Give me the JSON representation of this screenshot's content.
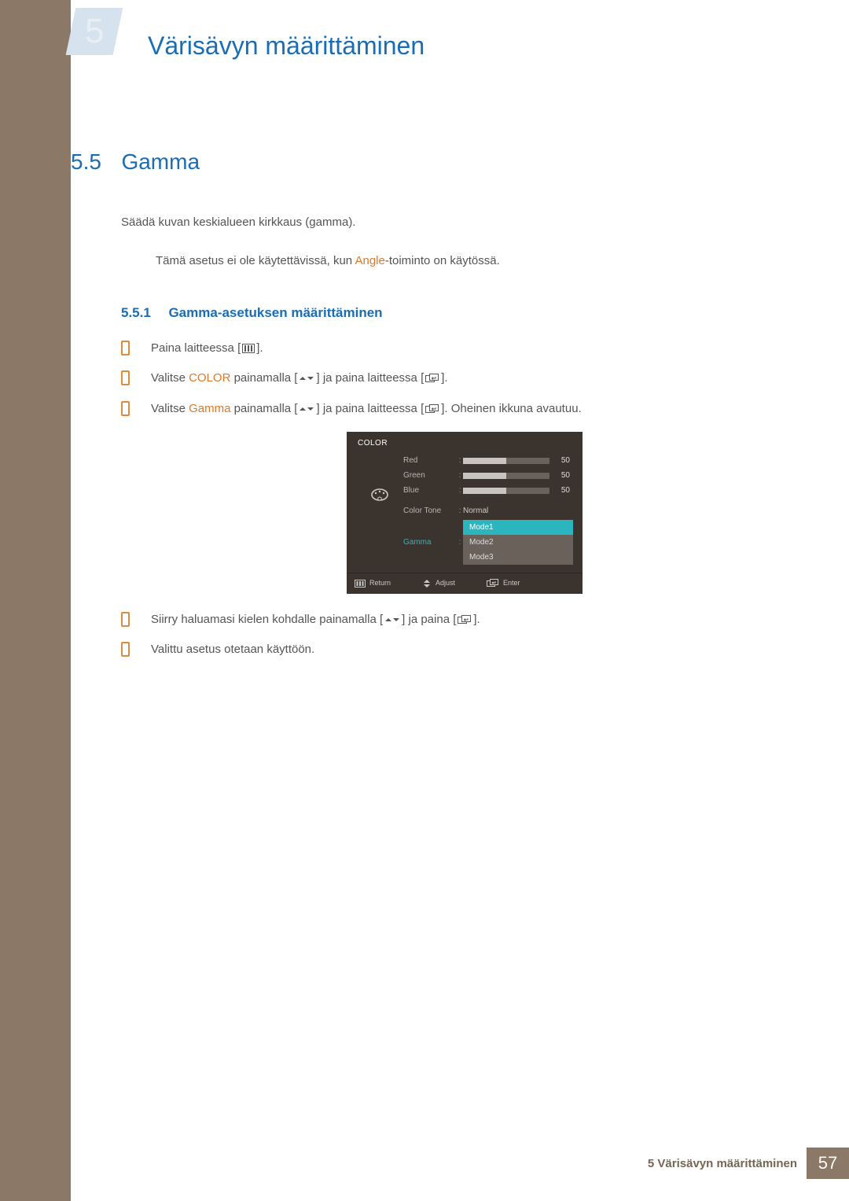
{
  "chapter": {
    "badge": "5",
    "title": "Värisävyn määrittäminen"
  },
  "section": {
    "num": "5.5",
    "title": "Gamma"
  },
  "paragraph1": "Säädä kuvan keskialueen kirkkaus (gamma).",
  "note": {
    "pre": "Tämä asetus ei ole käytettävissä, kun ",
    "angle": "Angle",
    "post": "-toiminto on käytössä."
  },
  "subsection": {
    "num": "5.5.1",
    "title": "Gamma-asetuksen määrittäminen"
  },
  "steps": {
    "s1": {
      "t1": "Paina laitteessa [",
      "t2": "]."
    },
    "s2": {
      "t1": "Valitse ",
      "color": "COLOR",
      "t2": " painamalla [",
      "t3": "] ja paina laitteessa [",
      "t4": "]."
    },
    "s3": {
      "t1": "Valitse ",
      "gamma": "Gamma",
      "t2": " painamalla [",
      "t3": "] ja paina laitteessa [",
      "t4": "]. Oheinen ikkuna avautuu."
    },
    "s4": {
      "t1": "Siirry haluamasi kielen kohdalle painamalla [",
      "t2": "] ja paina [",
      "t3": "]."
    },
    "s5": {
      "t1": "Valittu asetus otetaan käyttöön."
    }
  },
  "osd": {
    "header": "COLOR",
    "rows": {
      "red": {
        "label": "Red",
        "value": "50"
      },
      "green": {
        "label": "Green",
        "value": "50"
      },
      "blue": {
        "label": "Blue",
        "value": "50"
      },
      "colortone": {
        "label": "Color Tone",
        "value": "Normal"
      },
      "gamma": {
        "label": "Gamma",
        "options": [
          "Mode1",
          "Mode2",
          "Mode3"
        ],
        "o1": "Mode1",
        "o2": "Mode2",
        "o3": "Mode3"
      }
    },
    "footer": {
      "return": "Return",
      "adjust": "Adjust",
      "enter": "Enter"
    }
  },
  "footer": {
    "text": "5 Värisävyn määrittäminen",
    "page": "57"
  }
}
